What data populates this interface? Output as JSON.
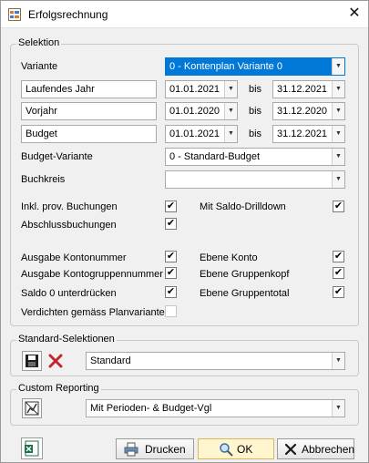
{
  "window": {
    "title": "Erfolgsrechnung",
    "close_glyph": "✕"
  },
  "selektion": {
    "title": "Selektion",
    "variante_label": "Variante",
    "variante_value": "0 - Kontenplan Variante 0",
    "rows": [
      {
        "label": "Laufendes Jahr",
        "from": "01.01.2021",
        "to": "31.12.2021"
      },
      {
        "label": "Vorjahr",
        "from": "01.01.2020",
        "to": "31.12.2020"
      },
      {
        "label": "Budget",
        "from": "01.01.2021",
        "to": "31.12.2021"
      }
    ],
    "bis": "bis",
    "budget_variante_label": "Budget-Variante",
    "budget_variante_value": "0 - Standard-Budget",
    "buchkreis_label": "Buchkreis",
    "buchkreis_value": "",
    "options": {
      "inkl_prov": {
        "label": "Inkl. prov. Buchungen",
        "checked": true
      },
      "mit_saldo": {
        "label": "Mit Saldo-Drilldown",
        "checked": true
      },
      "abschluss": {
        "label": "Abschlussbuchungen",
        "checked": true
      },
      "ausgabe_kontonummer": {
        "label": "Ausgabe Kontonummer",
        "checked": true
      },
      "ebene_konto": {
        "label": "Ebene Konto",
        "checked": true
      },
      "ausgabe_kontogruppennummer": {
        "label": "Ausgabe Kontogruppennummer",
        "checked": true
      },
      "ebene_gruppenkopf": {
        "label": "Ebene Gruppenkopf",
        "checked": true
      },
      "saldo_0": {
        "label": "Saldo 0 unterdrücken",
        "checked": true
      },
      "ebene_gruppentotal": {
        "label": "Ebene Gruppentotal",
        "checked": true
      },
      "verdichten": {
        "label": "Verdichten gemäss Planvariante",
        "checked": false
      }
    },
    "check_glyph": "✔"
  },
  "standard_selektionen": {
    "title": "Standard-Selektionen",
    "value": "Standard"
  },
  "custom_reporting": {
    "title": "Custom Reporting",
    "value": "Mit Perioden- & Budget-Vgl"
  },
  "footer": {
    "drucken": "Drucken",
    "ok": "OK",
    "abbrechen": "Abbrechen"
  },
  "colors": {
    "accent": "#0078d7",
    "primary_button": "#fff5cf",
    "delete_red": "#c0262d"
  }
}
